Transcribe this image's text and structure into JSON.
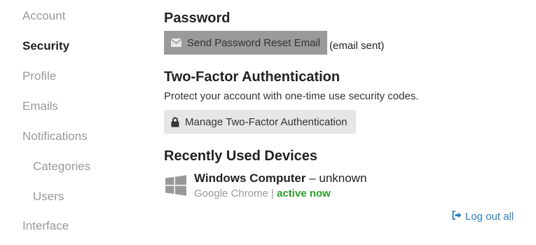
{
  "sidebar": {
    "items": [
      {
        "label": "Account"
      },
      {
        "label": "Security"
      },
      {
        "label": "Profile"
      },
      {
        "label": "Emails"
      },
      {
        "label": "Notifications"
      },
      {
        "label": "Categories"
      },
      {
        "label": "Users"
      },
      {
        "label": "Interface"
      }
    ],
    "active": "Security"
  },
  "password": {
    "heading": "Password",
    "reset_button_label": "Send Password Reset Email",
    "reset_button_icon": "envelope-icon",
    "status_note": "(email sent)"
  },
  "two_factor": {
    "heading": "Two-Factor Authentication",
    "description": "Protect your account with one-time use security codes.",
    "manage_button_label": "Manage Two-Factor Authentication",
    "manage_button_icon": "lock-icon"
  },
  "devices": {
    "heading": "Recently Used Devices",
    "items": [
      {
        "icon": "windows-icon",
        "name": "Windows Computer",
        "separator": " – ",
        "location": "unknown",
        "browser": "Google Chrome",
        "meta_separator": " | ",
        "status": "active now"
      }
    ]
  },
  "logout_all": {
    "label": "Log out all",
    "icon": "sign-out-icon"
  },
  "colors": {
    "accent_link": "#2a7fbf",
    "status_active": "#2a9d2a",
    "muted_text": "#999999",
    "disabled_button": "#9a9a9a"
  }
}
